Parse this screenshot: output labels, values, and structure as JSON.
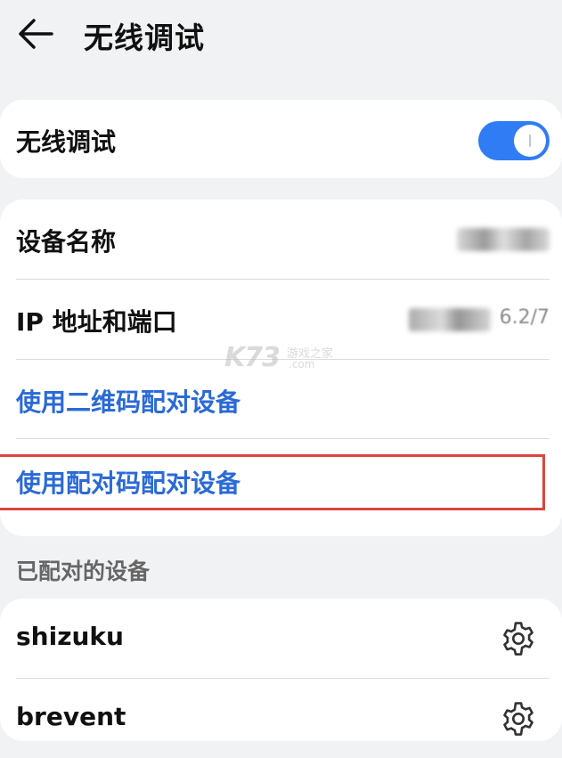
{
  "header": {
    "title": "无线调试",
    "back_icon": "arrow-left-icon"
  },
  "toggle_card": {
    "label": "无线调试",
    "enabled": true,
    "accent": "#2f7cf4"
  },
  "info_card": {
    "device_name_label": "设备名称",
    "ip_label": "IP 地址和端口",
    "ip_visible_suffix": "6.2/7",
    "qr_pair_label": "使用二维码配对设备",
    "code_pair_label": "使用配对码配对设备",
    "link_color": "#2b6ad6"
  },
  "paired": {
    "section_title": "已配对的设备",
    "devices": [
      {
        "name": "shizuku",
        "icon": "gear-icon"
      },
      {
        "name": "brevent",
        "icon": "gear-icon"
      }
    ]
  },
  "watermark": {
    "brand": "K73",
    "tagline": "游戏之家",
    "domain": ".com"
  },
  "highlight_color": "#d9473f"
}
